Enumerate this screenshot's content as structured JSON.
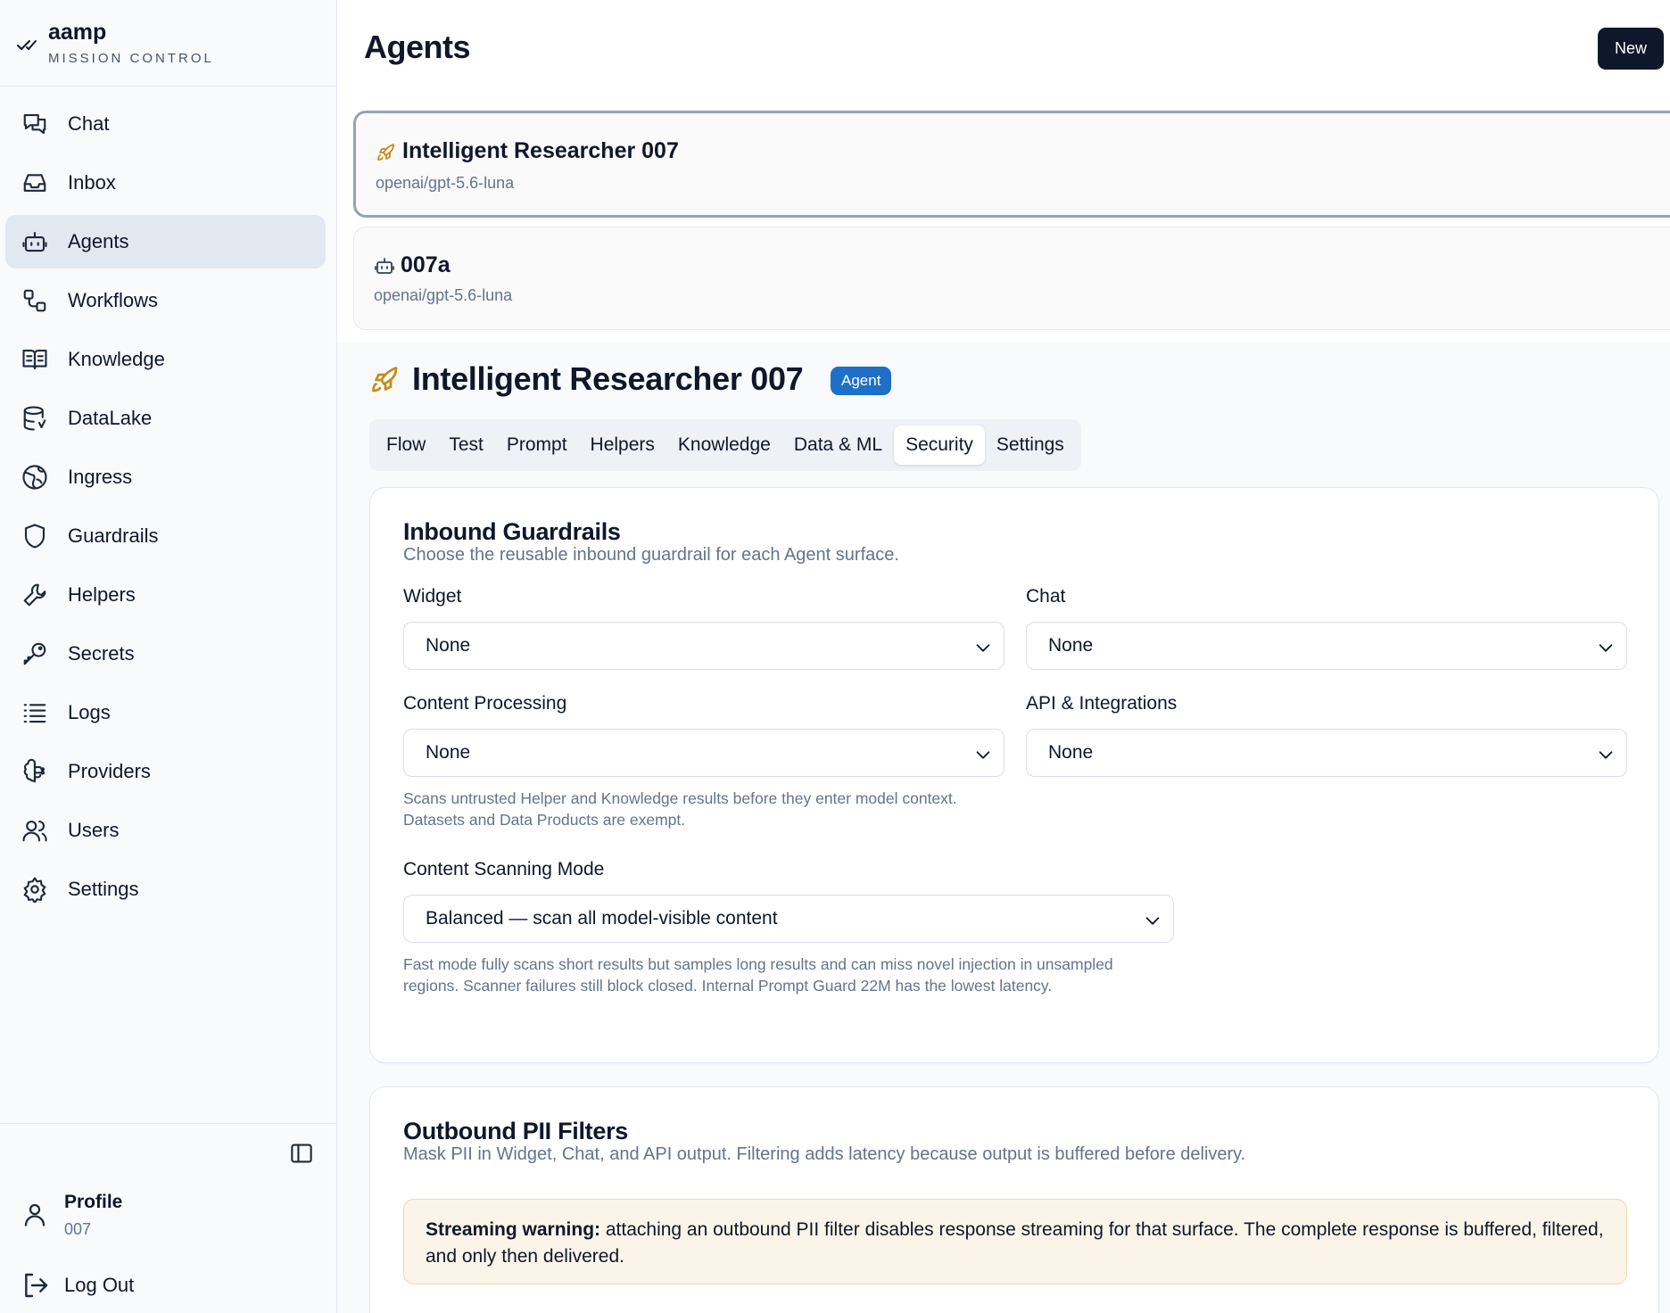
{
  "brand": {
    "name": "aamp",
    "subtitle": "MISSION CONTROL"
  },
  "sidebar": {
    "items": [
      {
        "label": "Chat",
        "icon": "chat-icon"
      },
      {
        "label": "Inbox",
        "icon": "inbox-icon"
      },
      {
        "label": "Agents",
        "icon": "robot-icon",
        "active": true
      },
      {
        "label": "Workflows",
        "icon": "workflow-icon"
      },
      {
        "label": "Knowledge",
        "icon": "book-icon"
      },
      {
        "label": "DataLake",
        "icon": "database-icon"
      },
      {
        "label": "Ingress",
        "icon": "globe-icon"
      },
      {
        "label": "Guardrails",
        "icon": "shield-icon"
      },
      {
        "label": "Helpers",
        "icon": "wrench-icon"
      },
      {
        "label": "Secrets",
        "icon": "key-icon"
      },
      {
        "label": "Logs",
        "icon": "list-icon"
      },
      {
        "label": "Providers",
        "icon": "brain-icon"
      },
      {
        "label": "Users",
        "icon": "users-icon"
      },
      {
        "label": "Settings",
        "icon": "gear-icon"
      }
    ],
    "profile": {
      "label": "Profile",
      "id": "007"
    },
    "logout": "Log Out"
  },
  "header": {
    "title": "Agents",
    "new_label": "New"
  },
  "agents": [
    {
      "name": "Intelligent Researcher 007",
      "model": "openai/gpt-5.6-luna",
      "icon": "rocket-icon",
      "selected": true
    },
    {
      "name": "007a",
      "model": "openai/gpt-5.6-luna",
      "icon": "robot-icon"
    }
  ],
  "detail": {
    "title": "Intelligent Researcher 007",
    "badge": "Agent",
    "tabs": [
      "Flow",
      "Test",
      "Prompt",
      "Helpers",
      "Knowledge",
      "Data & ML",
      "Security",
      "Settings"
    ],
    "active_tab": "Security"
  },
  "inbound": {
    "title": "Inbound Guardrails",
    "description": "Choose the reusable inbound guardrail for each Agent surface.",
    "widget_label": "Widget",
    "widget_value": "None",
    "chat_label": "Chat",
    "chat_value": "None",
    "content_label": "Content Processing",
    "content_value": "None",
    "api_label": "API & Integrations",
    "api_value": "None",
    "content_help": "Scans untrusted Helper and Knowledge results before they enter model context. Datasets and Data Products are exempt.",
    "scan_label": "Content Scanning Mode",
    "scan_value": "Balanced — scan all model-visible content",
    "scan_help": "Fast mode fully scans short results but samples long results and can miss novel injection in unsampled regions. Scanner failures still block closed. Internal Prompt Guard 22M has the lowest latency."
  },
  "outbound": {
    "title": "Outbound PII Filters",
    "description": "Mask PII in Widget, Chat, and API output. Filtering adds latency because output is buffered before delivery.",
    "warning_strong": "Streaming warning:",
    "warning_text": " attaching an outbound PII filter disables response streaming for that surface. The complete response is buffered, filtered, and only then delivered."
  },
  "colors": {
    "accent": "#1d6fc9",
    "primary_dark": "#0f172a",
    "rocket": "#c98a1a",
    "warning_bg": "#fbf5e9"
  }
}
